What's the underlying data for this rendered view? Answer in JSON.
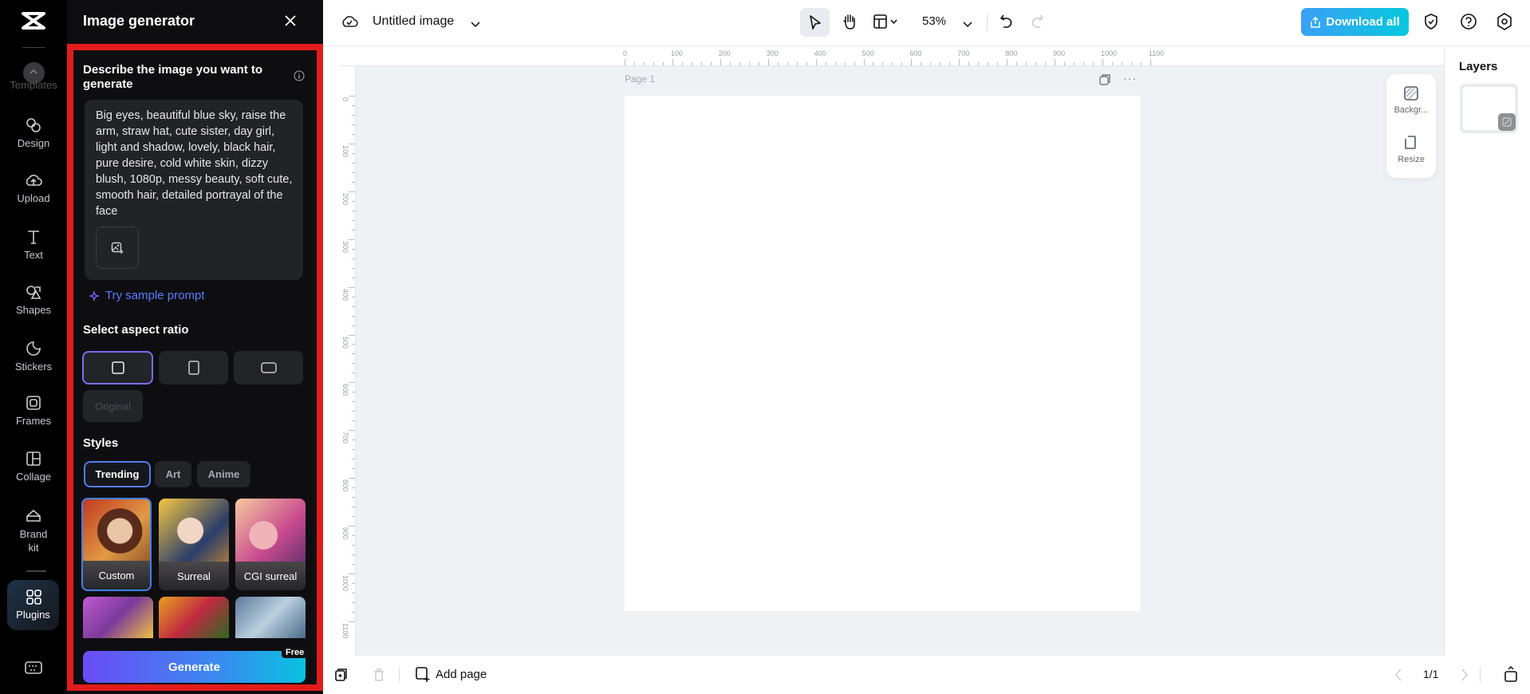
{
  "rail": {
    "items": [
      {
        "label": "Templates",
        "icon": "chevron-up-icon"
      },
      {
        "label": "Design",
        "icon": "design-icon"
      },
      {
        "label": "Upload",
        "icon": "upload-cloud-icon"
      },
      {
        "label": "Text",
        "icon": "text-icon"
      },
      {
        "label": "Shapes",
        "icon": "shapes-icon"
      },
      {
        "label": "Stickers",
        "icon": "sticker-icon"
      },
      {
        "label": "Frames",
        "icon": "frame-icon"
      },
      {
        "label": "Collage",
        "icon": "collage-icon"
      },
      {
        "label": "Brand kit",
        "icon": "brand-kit-icon"
      },
      {
        "label": "Plugins",
        "icon": "plugins-icon"
      }
    ]
  },
  "panel": {
    "title": "Image generator",
    "prompt_heading": "Describe the image you want to generate",
    "prompt_value": "Big eyes, beautiful blue sky, raise the arm, straw hat, cute sister, day girl, light and shadow, lovely, black hair, pure desire, cold white skin, dizzy blush, 1080p, messy beauty, soft cute, smooth hair, detailed portrayal of the face",
    "sample_prompt": "Try sample prompt",
    "aspect_heading": "Select aspect ratio",
    "aspect_ratios": [
      "square",
      "portrait",
      "landscape"
    ],
    "original_label": "Original",
    "styles_heading": "Styles",
    "style_tabs": [
      "Trending",
      "Art",
      "Anime"
    ],
    "styles": [
      "Custom",
      "Surreal",
      "CGI surreal"
    ],
    "generate_label": "Generate",
    "free_badge": "Free"
  },
  "topbar": {
    "title": "Untitled image",
    "zoom": "53%",
    "download_label": "Download all"
  },
  "canvas": {
    "page_label": "Page 1",
    "ruler_labels": [
      "0",
      "100",
      "200",
      "300",
      "400",
      "500",
      "600",
      "700",
      "800",
      "900",
      "1000",
      "1100"
    ]
  },
  "floating": {
    "background_label": "Backgr...",
    "resize_label": "Resize"
  },
  "layers": {
    "title": "Layers"
  },
  "bottom": {
    "add_page": "Add page",
    "page_count": "1/1"
  },
  "colors": {
    "accent": "#4f7df0",
    "download_start": "#3aa0f5",
    "download_end": "#07c8de",
    "generate_start": "#6a4cf6",
    "generate_end": "#08c2e0",
    "highlight": "#e31c1c"
  }
}
